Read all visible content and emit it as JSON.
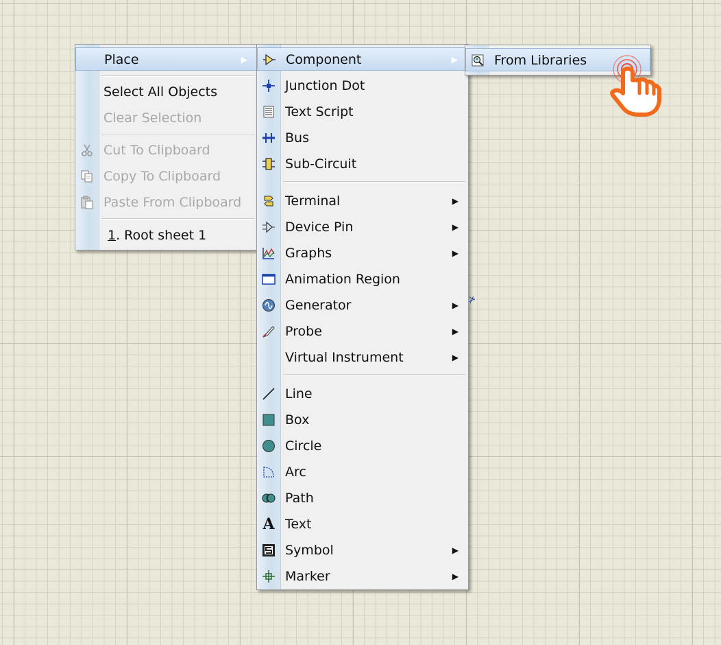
{
  "context_menu": {
    "items": [
      {
        "label": "Place",
        "disabled": false
      },
      {
        "label": "Select All Objects",
        "disabled": false
      },
      {
        "label": "Clear Selection",
        "disabled": true
      },
      {
        "label": "Cut To Clipboard",
        "disabled": true,
        "icon": "scissors-icon"
      },
      {
        "label": "Copy To Clipboard",
        "disabled": true,
        "icon": "copy-icon"
      },
      {
        "label": "Paste From Clipboard",
        "disabled": true,
        "icon": "paste-icon"
      },
      {
        "label_num": "1",
        "label_rest": ". Root sheet 1",
        "disabled": false
      }
    ]
  },
  "place_submenu": {
    "items": [
      {
        "label": "Component",
        "icon": "component-icon"
      },
      {
        "label": "Junction Dot",
        "icon": "junction-dot-icon"
      },
      {
        "label": "Text Script",
        "icon": "text-script-icon"
      },
      {
        "label": "Bus",
        "icon": "bus-icon"
      },
      {
        "label": "Sub-Circuit",
        "icon": "sub-circuit-icon"
      },
      {
        "label": "Terminal",
        "icon": "terminal-icon"
      },
      {
        "label": "Device Pin",
        "icon": "device-pin-icon"
      },
      {
        "label": "Graphs",
        "icon": "graphs-icon"
      },
      {
        "label": "Animation Region",
        "icon": "animation-region-icon"
      },
      {
        "label": "Generator",
        "icon": "generator-icon"
      },
      {
        "label": "Probe",
        "icon": "probe-icon"
      },
      {
        "label": "Virtual Instrument",
        "icon": ""
      },
      {
        "label": "Line",
        "icon": "line-icon"
      },
      {
        "label": "Box",
        "icon": "box-icon"
      },
      {
        "label": "Circle",
        "icon": "circle-icon"
      },
      {
        "label": "Arc",
        "icon": "arc-icon"
      },
      {
        "label": "Path",
        "icon": "path-icon"
      },
      {
        "label": "Text",
        "icon": "text-icon"
      },
      {
        "label": "Symbol",
        "icon": "symbol-icon"
      },
      {
        "label": "Marker",
        "icon": "marker-icon"
      }
    ]
  },
  "component_submenu": {
    "items": [
      {
        "label": "From Libraries",
        "icon": "library-search-icon"
      }
    ]
  },
  "cursor": {
    "icon": "hand-pointer-icon",
    "color": "#f26b1d"
  },
  "colors": {
    "highlight": "#c7dbf1",
    "disabled_text": "#a8a8a8",
    "cursor_accent": "#f26b1d"
  }
}
